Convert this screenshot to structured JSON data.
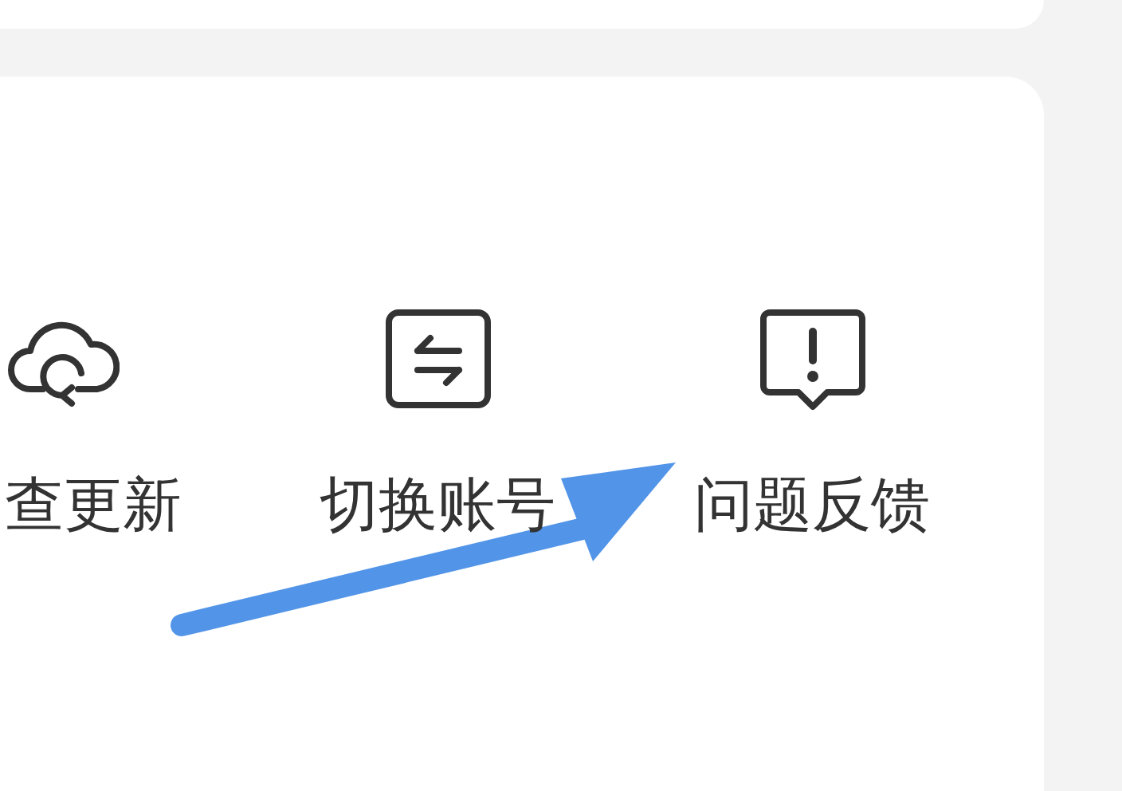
{
  "actions": [
    {
      "kind": "cloud",
      "label": "查更新"
    },
    {
      "kind": "swap",
      "label": "切换账号"
    },
    {
      "kind": "alert",
      "label": "问题反馈"
    }
  ]
}
